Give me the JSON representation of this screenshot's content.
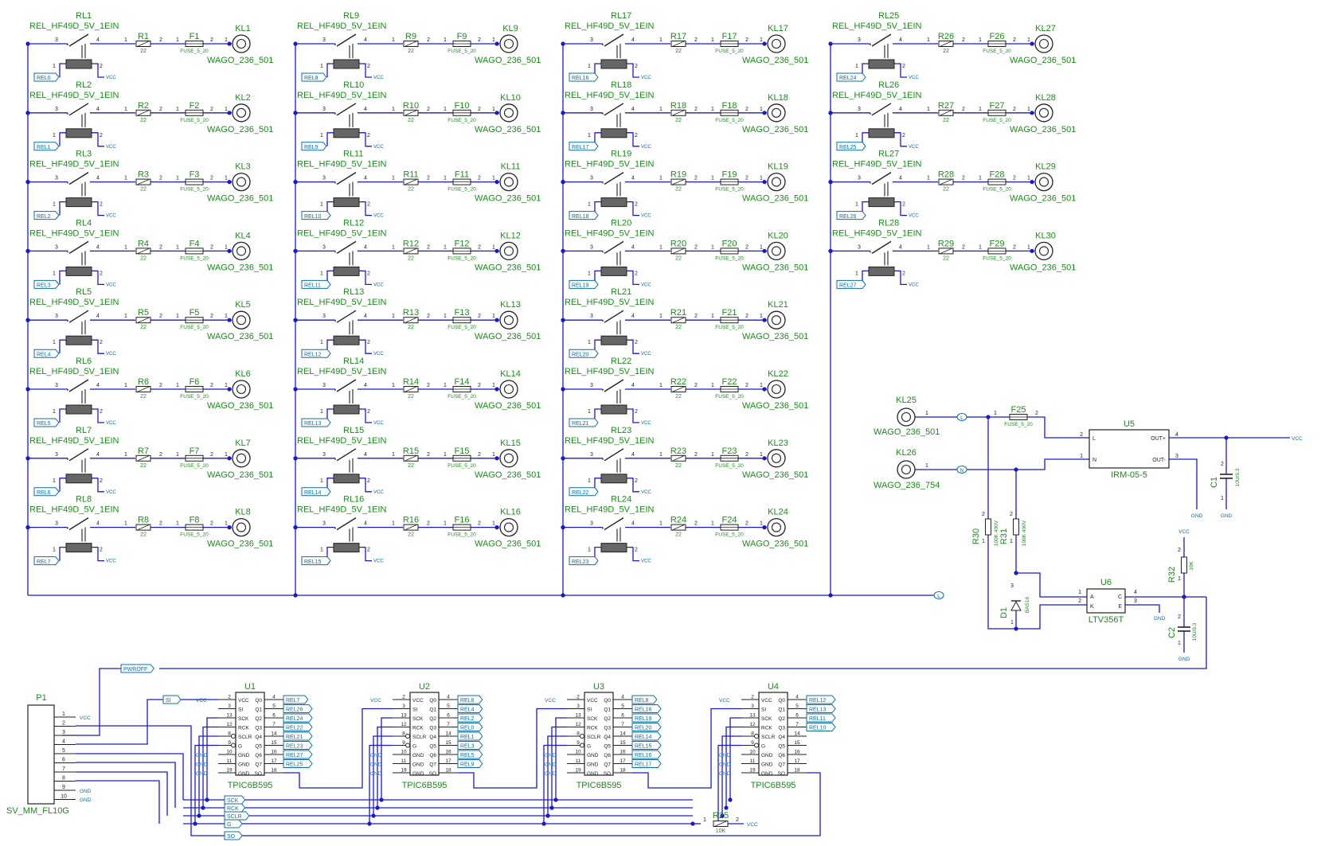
{
  "colors": {
    "wire": "#1a1acc",
    "label": "#1f8a1f",
    "body": "#222222",
    "net": "#0b6fa0",
    "junction": "#1a1acc"
  },
  "relays": [
    {
      "ref": "RL1",
      "value": "REL_HF49D_5V_1EIN",
      "res": "R1",
      "res_val": "22",
      "fuse": "F1",
      "fuse_val": "FUSE_5_20",
      "term": "KL1",
      "term_val": "WAGO_236_501",
      "net": "REL0"
    },
    {
      "ref": "RL2",
      "value": "REL_HF49D_5V_1EIN",
      "res": "R2",
      "res_val": "22",
      "fuse": "F2",
      "fuse_val": "FUSE_5_20",
      "term": "KL2",
      "term_val": "WAGO_236_501",
      "net": "REL1"
    },
    {
      "ref": "RL3",
      "value": "REL_HF49D_5V_1EIN",
      "res": "R3",
      "res_val": "22",
      "fuse": "F3",
      "fuse_val": "FUSE_5_20",
      "term": "KL3",
      "term_val": "WAGO_236_501",
      "net": "REL2"
    },
    {
      "ref": "RL4",
      "value": "REL_HF49D_5V_1EIN",
      "res": "R4",
      "res_val": "22",
      "fuse": "F4",
      "fuse_val": "FUSE_5_20",
      "term": "KL4",
      "term_val": "WAGO_236_501",
      "net": "REL3"
    },
    {
      "ref": "RL5",
      "value": "REL_HF49D_5V_1EIN",
      "res": "R5",
      "res_val": "22",
      "fuse": "F5",
      "fuse_val": "FUSE_5_20",
      "term": "KL5",
      "term_val": "WAGO_236_501",
      "net": "REL4"
    },
    {
      "ref": "RL6",
      "value": "REL_HF49D_5V_1EIN",
      "res": "R6",
      "res_val": "22",
      "fuse": "F6",
      "fuse_val": "FUSE_5_20",
      "term": "KL6",
      "term_val": "WAGO_236_501",
      "net": "REL5"
    },
    {
      "ref": "RL7",
      "value": "REL_HF49D_5V_1EIN",
      "res": "R7",
      "res_val": "22",
      "fuse": "F7",
      "fuse_val": "FUSE_5_20",
      "term": "KL7",
      "term_val": "WAGO_236_501",
      "net": "REL6"
    },
    {
      "ref": "RL8",
      "value": "REL_HF49D_5V_1EIN",
      "res": "R8",
      "res_val": "22",
      "fuse": "F8",
      "fuse_val": "FUSE_5_20",
      "term": "KL8",
      "term_val": "WAGO_236_501",
      "net": "REL7"
    },
    {
      "ref": "RL9",
      "value": "REL_HF49D_5V_1EIN",
      "res": "R9",
      "res_val": "22",
      "fuse": "F9",
      "fuse_val": "FUSE_5_20",
      "term": "KL9",
      "term_val": "WAGO_236_501",
      "net": "REL8"
    },
    {
      "ref": "RL10",
      "value": "REL_HF49D_5V_1EIN",
      "res": "R10",
      "res_val": "22",
      "fuse": "F10",
      "fuse_val": "FUSE_5_20",
      "term": "KL10",
      "term_val": "WAGO_236_501",
      "net": "REL9"
    },
    {
      "ref": "RL11",
      "value": "REL_HF49D_5V_1EIN",
      "res": "R11",
      "res_val": "22",
      "fuse": "F11",
      "fuse_val": "FUSE_5_20",
      "term": "KL11",
      "term_val": "WAGO_236_501",
      "net": "REL10"
    },
    {
      "ref": "RL12",
      "value": "REL_HF49D_5V_1EIN",
      "res": "R12",
      "res_val": "22",
      "fuse": "F12",
      "fuse_val": "FUSE_5_20",
      "term": "KL12",
      "term_val": "WAGO_236_501",
      "net": "REL11"
    },
    {
      "ref": "RL13",
      "value": "REL_HF49D_5V_1EIN",
      "res": "R13",
      "res_val": "22",
      "fuse": "F13",
      "fuse_val": "FUSE_5_20",
      "term": "KL13",
      "term_val": "WAGO_236_501",
      "net": "REL12"
    },
    {
      "ref": "RL14",
      "value": "REL_HF49D_5V_1EIN",
      "res": "R14",
      "res_val": "22",
      "fuse": "F14",
      "fuse_val": "FUSE_5_20",
      "term": "KL14",
      "term_val": "WAGO_236_501",
      "net": "REL13"
    },
    {
      "ref": "RL15",
      "value": "REL_HF49D_5V_1EIN",
      "res": "R15",
      "res_val": "22",
      "fuse": "F15",
      "fuse_val": "FUSE_5_20",
      "term": "KL15",
      "term_val": "WAGO_236_501",
      "net": "REL14"
    },
    {
      "ref": "RL16",
      "value": "REL_HF49D_5V_1EIN",
      "res": "R16",
      "res_val": "22",
      "fuse": "F16",
      "fuse_val": "FUSE_5_20",
      "term": "KL16",
      "term_val": "WAGO_236_501",
      "net": "REL15"
    },
    {
      "ref": "RL17",
      "value": "REL_HF49D_5V_1EIN",
      "res": "R17",
      "res_val": "22",
      "fuse": "F17",
      "fuse_val": "FUSE_5_20",
      "term": "KL17",
      "term_val": "WAGO_236_501",
      "net": "REL16"
    },
    {
      "ref": "RL18",
      "value": "REL_HF49D_5V_1EIN",
      "res": "R18",
      "res_val": "22",
      "fuse": "F18",
      "fuse_val": "FUSE_5_20",
      "term": "KL18",
      "term_val": "WAGO_236_501",
      "net": "REL17"
    },
    {
      "ref": "RL19",
      "value": "REL_HF49D_5V_1EIN",
      "res": "R19",
      "res_val": "22",
      "fuse": "F19",
      "fuse_val": "FUSE_5_20",
      "term": "KL19",
      "term_val": "WAGO_236_501",
      "net": "REL18"
    },
    {
      "ref": "RL20",
      "value": "REL_HF49D_5V_1EIN",
      "res": "R20",
      "res_val": "22",
      "fuse": "F20",
      "fuse_val": "FUSE_5_20",
      "term": "KL20",
      "term_val": "WAGO_236_501",
      "net": "REL19"
    },
    {
      "ref": "RL21",
      "value": "REL_HF49D_5V_1EIN",
      "res": "R21",
      "res_val": "22",
      "fuse": "F21",
      "fuse_val": "FUSE_5_20",
      "term": "KL21",
      "term_val": "WAGO_236_501",
      "net": "REL20"
    },
    {
      "ref": "RL22",
      "value": "REL_HF49D_5V_1EIN",
      "res": "R22",
      "res_val": "22",
      "fuse": "F22",
      "fuse_val": "FUSE_5_20",
      "term": "KL22",
      "term_val": "WAGO_236_501",
      "net": "REL21"
    },
    {
      "ref": "RL23",
      "value": "REL_HF49D_5V_1EIN",
      "res": "R23",
      "res_val": "22",
      "fuse": "F23",
      "fuse_val": "FUSE_5_20",
      "term": "KL23",
      "term_val": "WAGO_236_501",
      "net": "REL22"
    },
    {
      "ref": "RL24",
      "value": "REL_HF49D_5V_1EIN",
      "res": "R24",
      "res_val": "22",
      "fuse": "F24",
      "fuse_val": "FUSE_5_20",
      "term": "KL24",
      "term_val": "WAGO_236_501",
      "net": "REL23"
    },
    {
      "ref": "RL25",
      "value": "REL_HF49D_5V_1EIN",
      "res": "R26",
      "res_val": "22",
      "fuse": "F26",
      "fuse_val": "FUSE_5_20",
      "term": "KL27",
      "term_val": "WAGO_236_501",
      "net": "REL24"
    },
    {
      "ref": "RL26",
      "value": "REL_HF49D_5V_1EIN",
      "res": "R27",
      "res_val": "22",
      "fuse": "F27",
      "fuse_val": "FUSE_5_20",
      "term": "KL28",
      "term_val": "WAGO_236_501",
      "net": "REL25"
    },
    {
      "ref": "RL27",
      "value": "REL_HF49D_5V_1EIN",
      "res": "R28",
      "res_val": "22",
      "fuse": "F28",
      "fuse_val": "FUSE_5_20",
      "term": "KL29",
      "term_val": "WAGO_236_501",
      "net": "REL26"
    },
    {
      "ref": "RL28",
      "value": "REL_HF49D_5V_1EIN",
      "res": "R29",
      "res_val": "22",
      "fuse": "F29",
      "fuse_val": "FUSE_5_20",
      "term": "KL30",
      "term_val": "WAGO_236_501",
      "net": "REL27"
    }
  ],
  "relay_pins": {
    "com": "3",
    "no": "4",
    "coil_a": "1",
    "coil_b": "2",
    "r_in": "1",
    "r_out": "2",
    "f_in": "1",
    "f_out": "2",
    "kl_pin": "1",
    "vcc": "VCC"
  },
  "mains": {
    "bus_label": "L"
  },
  "power": {
    "kl25": {
      "ref": "KL25",
      "value": "WAGO_236_501",
      "pin": "1",
      "net": "L"
    },
    "kl26": {
      "ref": "KL26",
      "value": "WAGO_236_754",
      "pin": "1",
      "net": "N"
    },
    "f25": {
      "ref": "F25",
      "value": "FUSE_5_20",
      "p1": "1",
      "p2": "2"
    },
    "u5": {
      "ref": "U5",
      "value": "IRM-05-5",
      "pin_l": "L",
      "pin_n": "N",
      "pin_outp": "OUT+",
      "pin_outm": "OUT-",
      "n2": "2",
      "n1": "1",
      "n4": "4",
      "n3": "3"
    },
    "c1": {
      "ref": "C1",
      "value": "10U/6.3",
      "p1": "1",
      "p2": "2"
    },
    "vcc": "VCC",
    "gnd": "GND",
    "r30": {
      "ref": "R30",
      "value": "100K 400V",
      "p1": "1",
      "p2": "2"
    },
    "r31": {
      "ref": "R31",
      "value": "100K 400V",
      "p1": "1",
      "p2": "2"
    },
    "d1": {
      "ref": "D1",
      "value": "BAS16",
      "p1": "1",
      "p3": "3"
    },
    "u6": {
      "ref": "U6",
      "value": "LTV356T",
      "pa": "A",
      "pk": "K",
      "pc": "C",
      "pe": "E",
      "n1": "1",
      "n2": "2",
      "n3": "3",
      "n4": "4"
    },
    "r32": {
      "ref": "R32",
      "value": "10K",
      "p1": "1",
      "p2": "2"
    },
    "c2": {
      "ref": "C2",
      "value": "10U/6.3",
      "p1": "1",
      "p2": "2"
    },
    "pwroff": "PWROFF"
  },
  "connector": {
    "ref": "P1",
    "value": "SV_MM_FL10G",
    "pins": [
      "1",
      "2",
      "3",
      "4",
      "5",
      "6",
      "7",
      "8",
      "9",
      "10"
    ],
    "pin1_net": "VCC",
    "pin9_net": "GND",
    "pin10_net": "GND"
  },
  "shift_chip": {
    "value": "TPIC6B595",
    "left_names": [
      "VCC",
      "SI",
      "SCK",
      "RCK",
      "SCLR",
      "G",
      "GND",
      "GND",
      "GND"
    ],
    "left_nums": [
      "2",
      "3",
      "13",
      "12",
      "8",
      "9",
      "10",
      "11",
      "19"
    ],
    "right_names": [
      "Q0",
      "Q1",
      "Q2",
      "Q3",
      "Q4",
      "Q5",
      "Q6",
      "Q7",
      "SO"
    ],
    "right_nums": [
      "4",
      "5",
      "6",
      "7",
      "14",
      "15",
      "16",
      "17",
      "18"
    ]
  },
  "shift_regs": [
    {
      "ref": "U1",
      "in_net": "SI",
      "outputs": [
        "REL7",
        "REL26",
        "REL24",
        "REL22",
        "REL21",
        "REL23",
        "REL27",
        "REL25"
      ]
    },
    {
      "ref": "U2",
      "in_net": "",
      "outputs": [
        "REL6",
        "REL4",
        "REL2",
        "REL0",
        "REL1",
        "REL3",
        "REL5",
        "REL9"
      ]
    },
    {
      "ref": "U3",
      "in_net": "",
      "outputs": [
        "REL8",
        "REL18",
        "REL19",
        "REL20",
        "REL14",
        "REL15",
        "REL16",
        "REL17"
      ]
    },
    {
      "ref": "U4",
      "in_net": "",
      "outputs": [
        "REL12",
        "REL13",
        "REL11",
        "REL10",
        "",
        "",
        "",
        ""
      ]
    }
  ],
  "bus_nets": {
    "sck": "SCK",
    "rck": "RCK",
    "sclr": "SCLR",
    "g": "G",
    "so": "SO"
  },
  "r25": {
    "ref": "R25",
    "value": "10K",
    "p1": "1",
    "p2": "2",
    "net": "VCC"
  }
}
